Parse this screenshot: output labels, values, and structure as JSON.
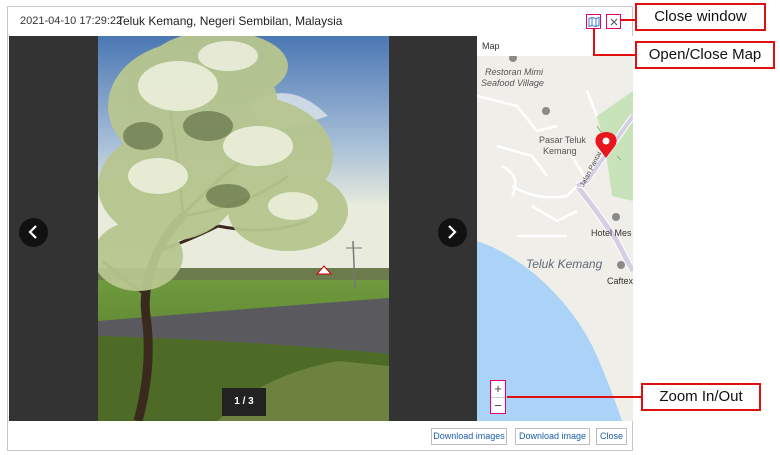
{
  "window": {
    "timestamp": "2021-04-10 17:29:22",
    "location": "Teluk Kemang, Negeri Sembilan, Malaysia"
  },
  "viewer": {
    "counter": "1 / 3",
    "prev_icon": "chevron-left-icon",
    "next_icon": "chevron-right-icon"
  },
  "map": {
    "header": "Map",
    "labels": {
      "restaurant_1": "Restoran Mimi",
      "restaurant_2": "Seafood Village",
      "pasar_1": "Pasar Teluk",
      "pasar_2": "Kemang",
      "road": "Jalan Pantai",
      "hotel": "Hotel Mes",
      "bay": "Teluk Kemang",
      "cafe": "Caftex"
    },
    "zoom_in": "+",
    "zoom_out": "−",
    "pin_color": "#e8141e",
    "water_color": "#aad3f7"
  },
  "footer": {
    "download_images": "Download images",
    "download_image": "Download image",
    "close": "Close"
  },
  "callouts": {
    "close_window": "Close window",
    "open_close_map": "Open/Close Map",
    "zoom": "Zoom In/Out"
  },
  "colors": {
    "highlight": "#e4006d",
    "callout_border": "#e01010",
    "link": "#1a5fa8"
  }
}
